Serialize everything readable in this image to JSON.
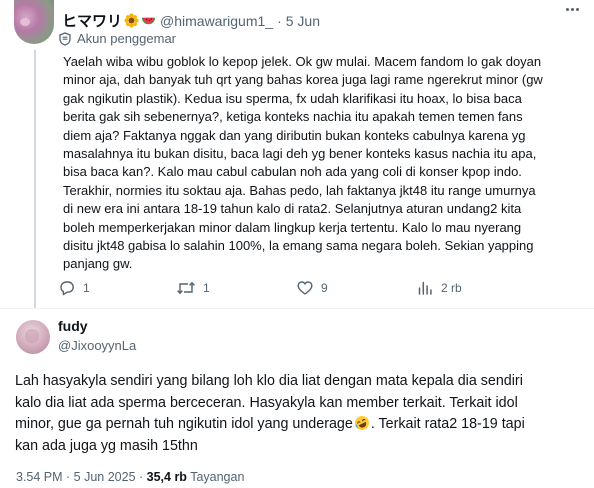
{
  "colors": {
    "text": "#0f1419",
    "muted": "#536471",
    "line": "#cfd9de",
    "divider": "#eff3f4"
  },
  "reply": {
    "display_name": "ヒマワリ",
    "emojis": [
      "sunflower-emoji",
      "watermelon-emoji"
    ],
    "handle": "@himawarigum1_",
    "separator": "·",
    "time": "5 Jun",
    "badge_label": "Akun penggemar",
    "lines": [
      "Yaelah wiba wibu goblok lo kepop jelek. Ok gw mulai. Macem fandom lo gak doyan",
      "minor aja, dah banyak tuh qrt yang bahas korea juga lagi rame ngerekrut minor (gw",
      "gak ngikutin plastik). Kedua isu sperma, fx udah klarifikasi itu hoax, lo bisa baca",
      "berita gak sih sebenernya?, ketiga konteks nachia itu apakah temen temen fans",
      "diem aja? Faktanya nggak dan yang diributin bukan konteks cabulnya karena yg",
      "masalahnya itu bukan disitu, baca lagi deh yg bener konteks kasus nachia itu apa,",
      "bisa baca kan?. Kalo mau cabul cabulan noh ada yang coli di konser kpop indo.",
      "Terakhir, normies itu soktau aja. Bahas pedo, lah faktanya jkt48 itu range umurnya",
      "di new era ini antara 18-19 tahun kalo di rata2. Selanjutnya aturan undang2 kita",
      "boleh memperkerjakan minor dalam lingkup kerja tertentu. Kalo lo mau nyerang",
      "disitu jkt48 gabisa lo salahin 100%, la emang sama negara boleh. Sekian yapping",
      "panjang gw."
    ],
    "actions": {
      "reply_count": "1",
      "repost_count": "1",
      "like_count": "9",
      "views_count": "2 rb"
    }
  },
  "tweet": {
    "display_name": "fudy",
    "handle": "@JixooyynLa",
    "lines": [
      "Lah hasyakyla sendiri yang bilang loh klo dia liat dengan mata kepala dia sendiri",
      "kalo dia liat ada sperma berceceran. Hasyakyla kan member terkait. Terkait idol",
      "minor, gue ga pernah tuh ngikutin idol yang underage",
      "kan ada juga yg masih 15thn"
    ],
    "line3_suffix": ". Terkait rata2 18-19 tapi",
    "inline_emoji": "rolling-laughing-emoji",
    "timestamp": "3.54 PM · 5 Jun 2025 ·",
    "views_number": "35,4 rb",
    "views_label": "Tayangan"
  }
}
